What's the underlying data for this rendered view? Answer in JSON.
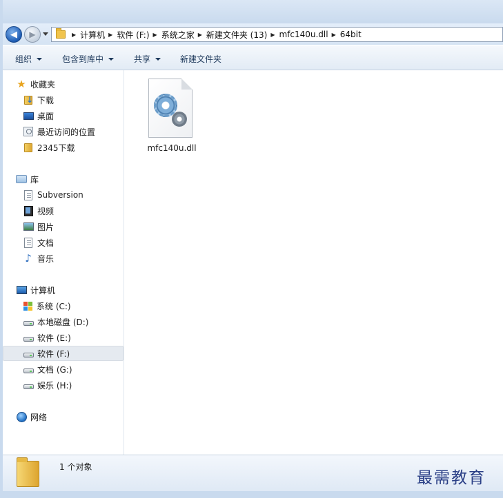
{
  "address_bar": {
    "breadcrumbs": [
      "计算机",
      "软件 (F:)",
      "系统之家",
      "新建文件夹 (13)",
      "mfc140u.dll",
      "64bit"
    ]
  },
  "toolbar": {
    "organize": "组织",
    "include_in_library": "包含到库中",
    "share": "共享",
    "new_folder": "新建文件夹"
  },
  "nav": {
    "favorites": {
      "title": "收藏夹",
      "items": [
        "下载",
        "桌面",
        "最近访问的位置",
        "2345下载"
      ]
    },
    "libraries": {
      "title": "库",
      "items": [
        "Subversion",
        "视频",
        "图片",
        "文档",
        "音乐"
      ]
    },
    "computer": {
      "title": "计算机",
      "drives": [
        "系统 (C:)",
        "本地磁盘 (D:)",
        "软件 (E:)",
        "软件 (F:)",
        "文档 (G:)",
        "娱乐 (H:)"
      ],
      "selected": "软件 (F:)"
    },
    "network": {
      "title": "网络"
    }
  },
  "content": {
    "files": [
      {
        "name": "mfc140u.dll",
        "icon": "dll-gear-file-icon"
      }
    ]
  },
  "status": {
    "count_text": "1 个对象"
  },
  "watermark": "最需教育"
}
